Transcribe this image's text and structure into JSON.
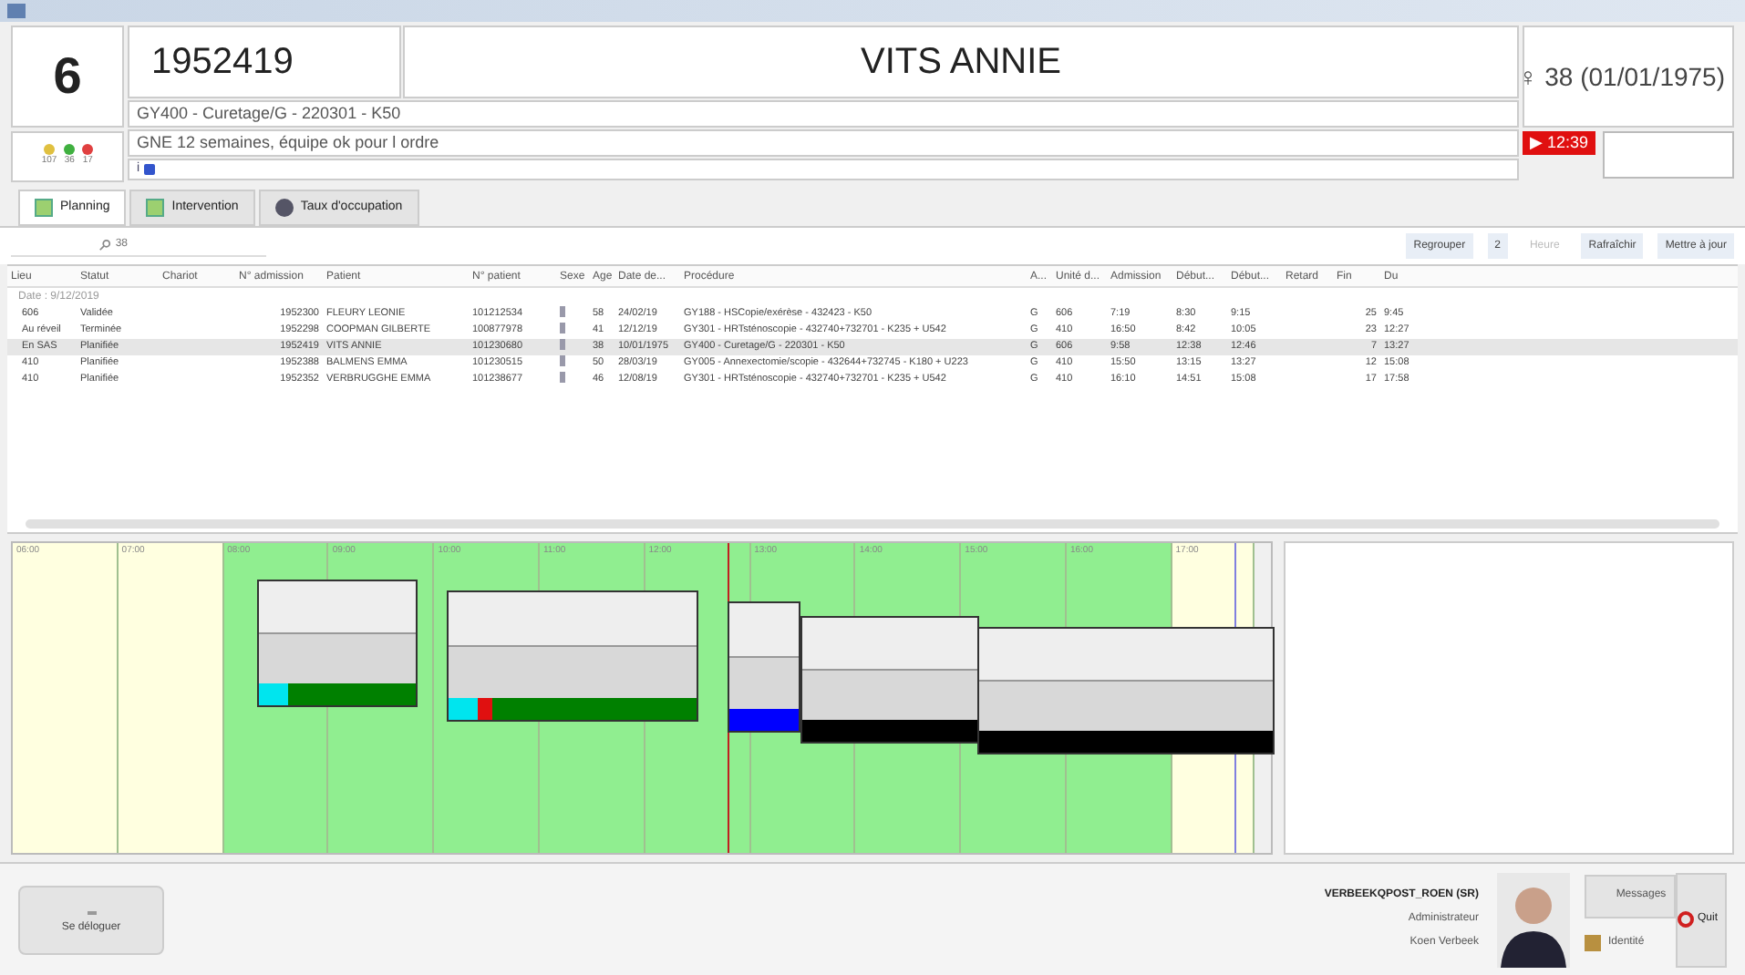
{
  "header": {
    "room": "6",
    "admission": "1952419",
    "patient": "VITS ANNIE",
    "age": "♀ 38 (01/01/1975)",
    "procedure": "GY400 - Curetage/G - 220301 - K50",
    "note": "GNE 12 semaines, équipe ok pour l ordre",
    "info": "i",
    "timer": "▶ 12:39",
    "lights": [
      {
        "color": "#e0c040",
        "count": "107"
      },
      {
        "color": "#40b040",
        "count": "36"
      },
      {
        "color": "#e04040",
        "count": "17"
      }
    ]
  },
  "tabs": [
    {
      "label": "Planning",
      "selected": true
    },
    {
      "label": "Intervention",
      "selected": false
    },
    {
      "label": "Taux d'occupation",
      "selected": false
    }
  ],
  "search": {
    "value": "38"
  },
  "toolbar": [
    {
      "label": "Regrouper",
      "disabled": false
    },
    {
      "label": "2",
      "disabled": false
    },
    {
      "label": "Heure",
      "disabled": true
    },
    {
      "label": "Rafraîchir",
      "disabled": false
    },
    {
      "label": "Mettre à jour",
      "disabled": false
    }
  ],
  "table": {
    "columns": [
      "Lieu",
      "Statut",
      "Chariot",
      "N° admission",
      "Patient",
      "N° patient",
      "Sexe",
      "Age",
      "Date de...",
      "Procédure",
      "A...",
      "Unité d...",
      "Admission",
      "Début...",
      "Début...",
      "Retard",
      "Fin",
      "Du"
    ],
    "group": "Date : 9/12/2019",
    "rows": [
      {
        "selected": false,
        "cells": [
          "606",
          "Validée",
          "",
          "1952300",
          "FLEURY LEONIE",
          "101212534",
          "",
          "58",
          "24/02/19",
          "GY188 - HSCopie/exérèse - 432423 - K50",
          "G",
          "606",
          "7:19",
          "8:30",
          "9:15",
          "",
          "25",
          "9:45"
        ]
      },
      {
        "selected": false,
        "cells": [
          "Au réveil",
          "Terminée",
          "",
          "1952298",
          "COOPMAN GILBERTE",
          "100877978",
          "",
          "41",
          "12/12/19",
          "GY301 - HRTsténoscopie - 432740+732701 - K235 + U542",
          "G",
          "410",
          "16:50",
          "8:42",
          "10:05",
          "",
          "23",
          "12:27"
        ]
      },
      {
        "selected": true,
        "cells": [
          "En SAS",
          "Planifiée",
          "",
          "1952419",
          "VITS ANNIE",
          "101230680",
          "",
          "38",
          "10/01/1975",
          "GY400 - Curetage/G - 220301 - K50",
          "G",
          "606",
          "9:58",
          "12:38",
          "12:46",
          "",
          "7",
          "13:27"
        ]
      },
      {
        "selected": false,
        "cells": [
          "410",
          "Planifiée",
          "",
          "1952388",
          "BALMENS EMMA",
          "101230515",
          "",
          "50",
          "28/03/19",
          "GY005 - Annexectomie/scopie - 432644+732745 - K180 + U223",
          "G",
          "410",
          "15:50",
          "13:15",
          "13:27",
          "",
          "12",
          "15:08"
        ]
      },
      {
        "selected": false,
        "cells": [
          "410",
          "Planifiée",
          "",
          "1952352",
          "VERBRUGGHE EMMA",
          "101238677",
          "",
          "46",
          "12/08/19",
          "GY301 - HRTsténoscopie - 432740+732701 - K235 + U542",
          "G",
          "410",
          "16:10",
          "14:51",
          "15:08",
          "",
          "17",
          "17:58"
        ]
      }
    ]
  },
  "gantt": {
    "hours": [
      "06:00",
      "07:00",
      "08:00",
      "09:00",
      "10:00",
      "11:00",
      "12:00",
      "13:00",
      "14:00",
      "15:00",
      "16:00",
      "17:00"
    ],
    "blocks": [
      {
        "color": "#008000"
      },
      {
        "color": "#008000"
      },
      {
        "color": "#0000ff"
      },
      {
        "color": "#000000"
      },
      {
        "color": "#000000"
      }
    ]
  },
  "footer": {
    "logout": "Se déloguer",
    "user": "VERBEEKQPOST_ROEN (SR)",
    "role": "Administrateur",
    "name": "Koen Verbeek",
    "messages": "Messages",
    "identity": "Identité",
    "quit": "Quit"
  }
}
